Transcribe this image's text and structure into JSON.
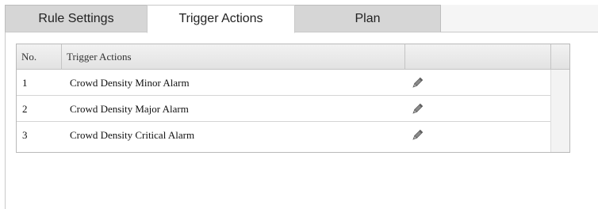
{
  "tabs": [
    {
      "label": "Rule Settings",
      "active": false
    },
    {
      "label": "Trigger Actions",
      "active": true
    },
    {
      "label": "Plan",
      "active": false
    }
  ],
  "table": {
    "columns": [
      "No.",
      "Trigger Actions",
      ""
    ],
    "rows": [
      {
        "no": "1",
        "action": "Crowd Density Minor Alarm",
        "edit_icon": "pencil-icon"
      },
      {
        "no": "2",
        "action": "Crowd Density Major Alarm",
        "edit_icon": "pencil-icon"
      },
      {
        "no": "3",
        "action": "Crowd Density Critical Alarm",
        "edit_icon": "pencil-icon"
      }
    ]
  },
  "colors": {
    "active_tab": "#ffffff",
    "inactive_tab": "#d6d6d6",
    "header": "#e8e8e8",
    "icon": "#6b6b6b"
  }
}
